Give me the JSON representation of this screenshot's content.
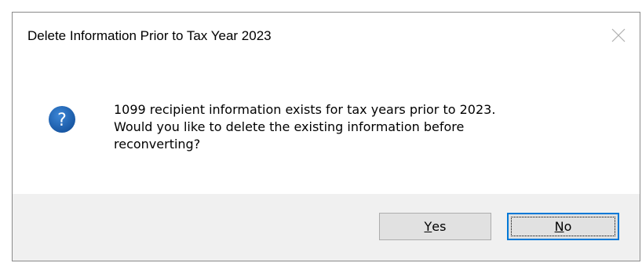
{
  "dialog": {
    "title": "Delete Information Prior to Tax Year 2023",
    "close_icon": "close-icon",
    "question_icon": "question-icon",
    "message": "1099 recipient information exists for tax years prior to 2023.\nWould you like to delete the existing information before\nreconverting?",
    "buttons": {
      "yes": {
        "mnemonic": "Y",
        "rest": "es"
      },
      "no": {
        "mnemonic": "N",
        "rest": "o"
      }
    },
    "colors": {
      "accent": "#0078d7",
      "icon_blue": "#1c63b7",
      "button_bar": "#f0f0f0",
      "button_face": "#e1e1e1"
    }
  }
}
